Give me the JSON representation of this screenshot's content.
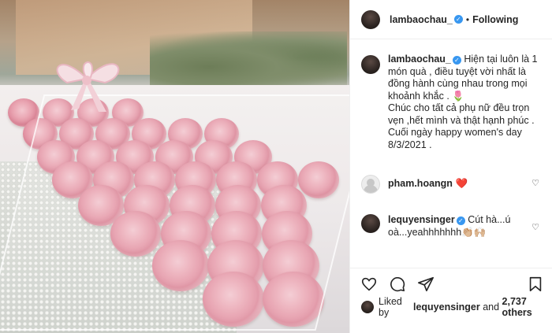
{
  "post": {
    "author": "lambaochau_",
    "follow_separator": "•",
    "follow_status": "Following",
    "verified_mark": "✓"
  },
  "caption": {
    "username": "lambaochau_",
    "text": "Hiện tại luôn là 1 món quà , điều tuyệt vời nhất là đồng hành cùng nhau trong mọi khoảnh khắc . 🌷\nChúc cho tất cả phụ nữ đều trọn vẹn ,hết mình và thật hạnh phúc .\nCuối ngày happy women's day\n8/3/2021 ."
  },
  "comments": [
    {
      "username": "pham.hoangn",
      "text": "❤️",
      "meta": ""
    },
    {
      "username": "lequyensinger",
      "text": "Cút hà...ú oà...yeahhhhhhh👏🏼🙌🏼",
      "meta": ""
    }
  ],
  "likes": {
    "prefix": "Liked by",
    "user": "lequyensinger",
    "conjunction": "and",
    "others": "2,737 others"
  },
  "icons": {
    "like": "heart-outline-icon",
    "comment": "speech-bubble-icon",
    "share": "paper-plane-icon",
    "save": "bookmark-icon"
  },
  "colors": {
    "verified": "#3897f0",
    "heart_red": "#ed4956",
    "divider": "#efefef",
    "muted": "#8e8e8e"
  }
}
